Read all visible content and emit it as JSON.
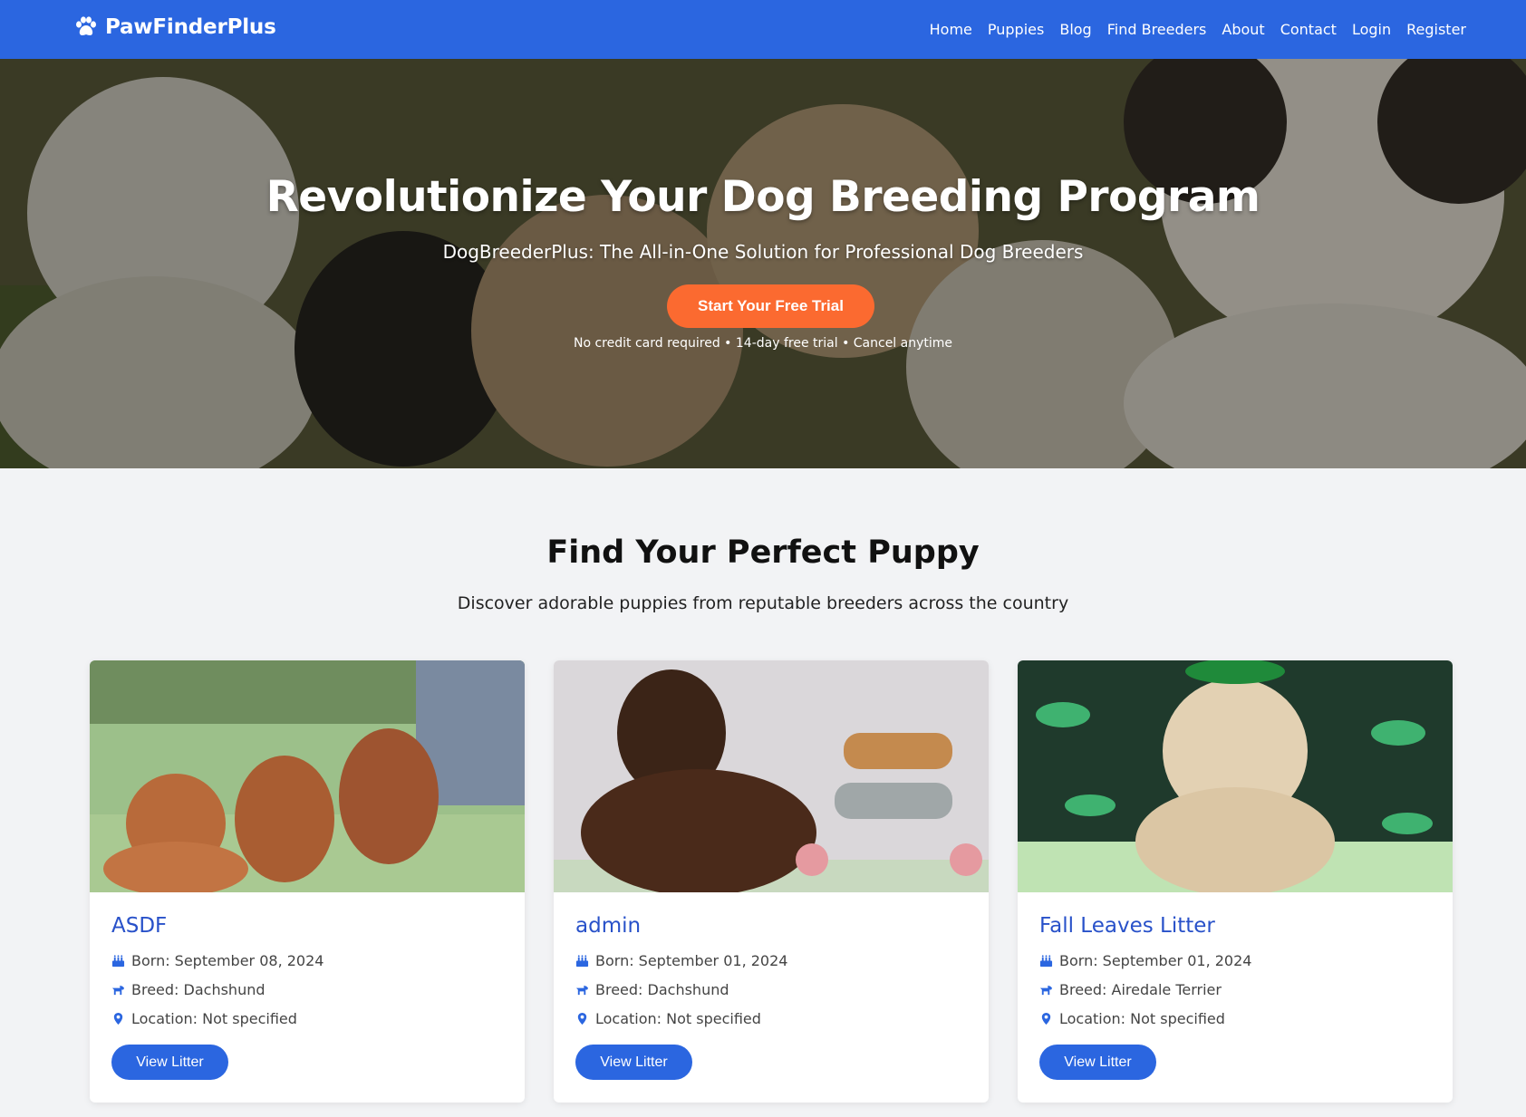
{
  "nav": {
    "brand": "PawFinderPlus",
    "links": [
      "Home",
      "Puppies",
      "Blog",
      "Find Breeders",
      "About",
      "Contact",
      "Login",
      "Register"
    ]
  },
  "hero": {
    "title": "Revolutionize Your Dog Breeding Program",
    "subtitle": "DogBreederPlus: The All-in-One Solution for Professional Dog Breeders",
    "cta": "Start Your Free Trial",
    "note": "No credit card required • 14-day free trial • Cancel anytime"
  },
  "section": {
    "title": "Find Your Perfect Puppy",
    "subtitle": "Discover adorable puppies from reputable breeders across the country"
  },
  "litters": [
    {
      "title": "ASDF",
      "born": "Born: September 08, 2024",
      "breed": "Breed: Dachshund",
      "location": "Location: Not specified",
      "button": "View Litter"
    },
    {
      "title": "admin",
      "born": "Born: September 01, 2024",
      "breed": "Breed: Dachshund",
      "location": "Location: Not specified",
      "button": "View Litter"
    },
    {
      "title": "Fall Leaves Litter",
      "born": "Born: September 01, 2024",
      "breed": "Breed: Airedale Terrier",
      "location": "Location: Not specified",
      "button": "View Litter"
    }
  ],
  "colors": {
    "primary": "#2b66e0",
    "cta": "#fb6a30",
    "card_title": "#2851c9",
    "background": "#f2f3f5"
  },
  "icons": {
    "brand": "paw-icon",
    "born": "birthday-cake-icon",
    "breed": "dog-icon",
    "location": "map-pin-icon"
  }
}
